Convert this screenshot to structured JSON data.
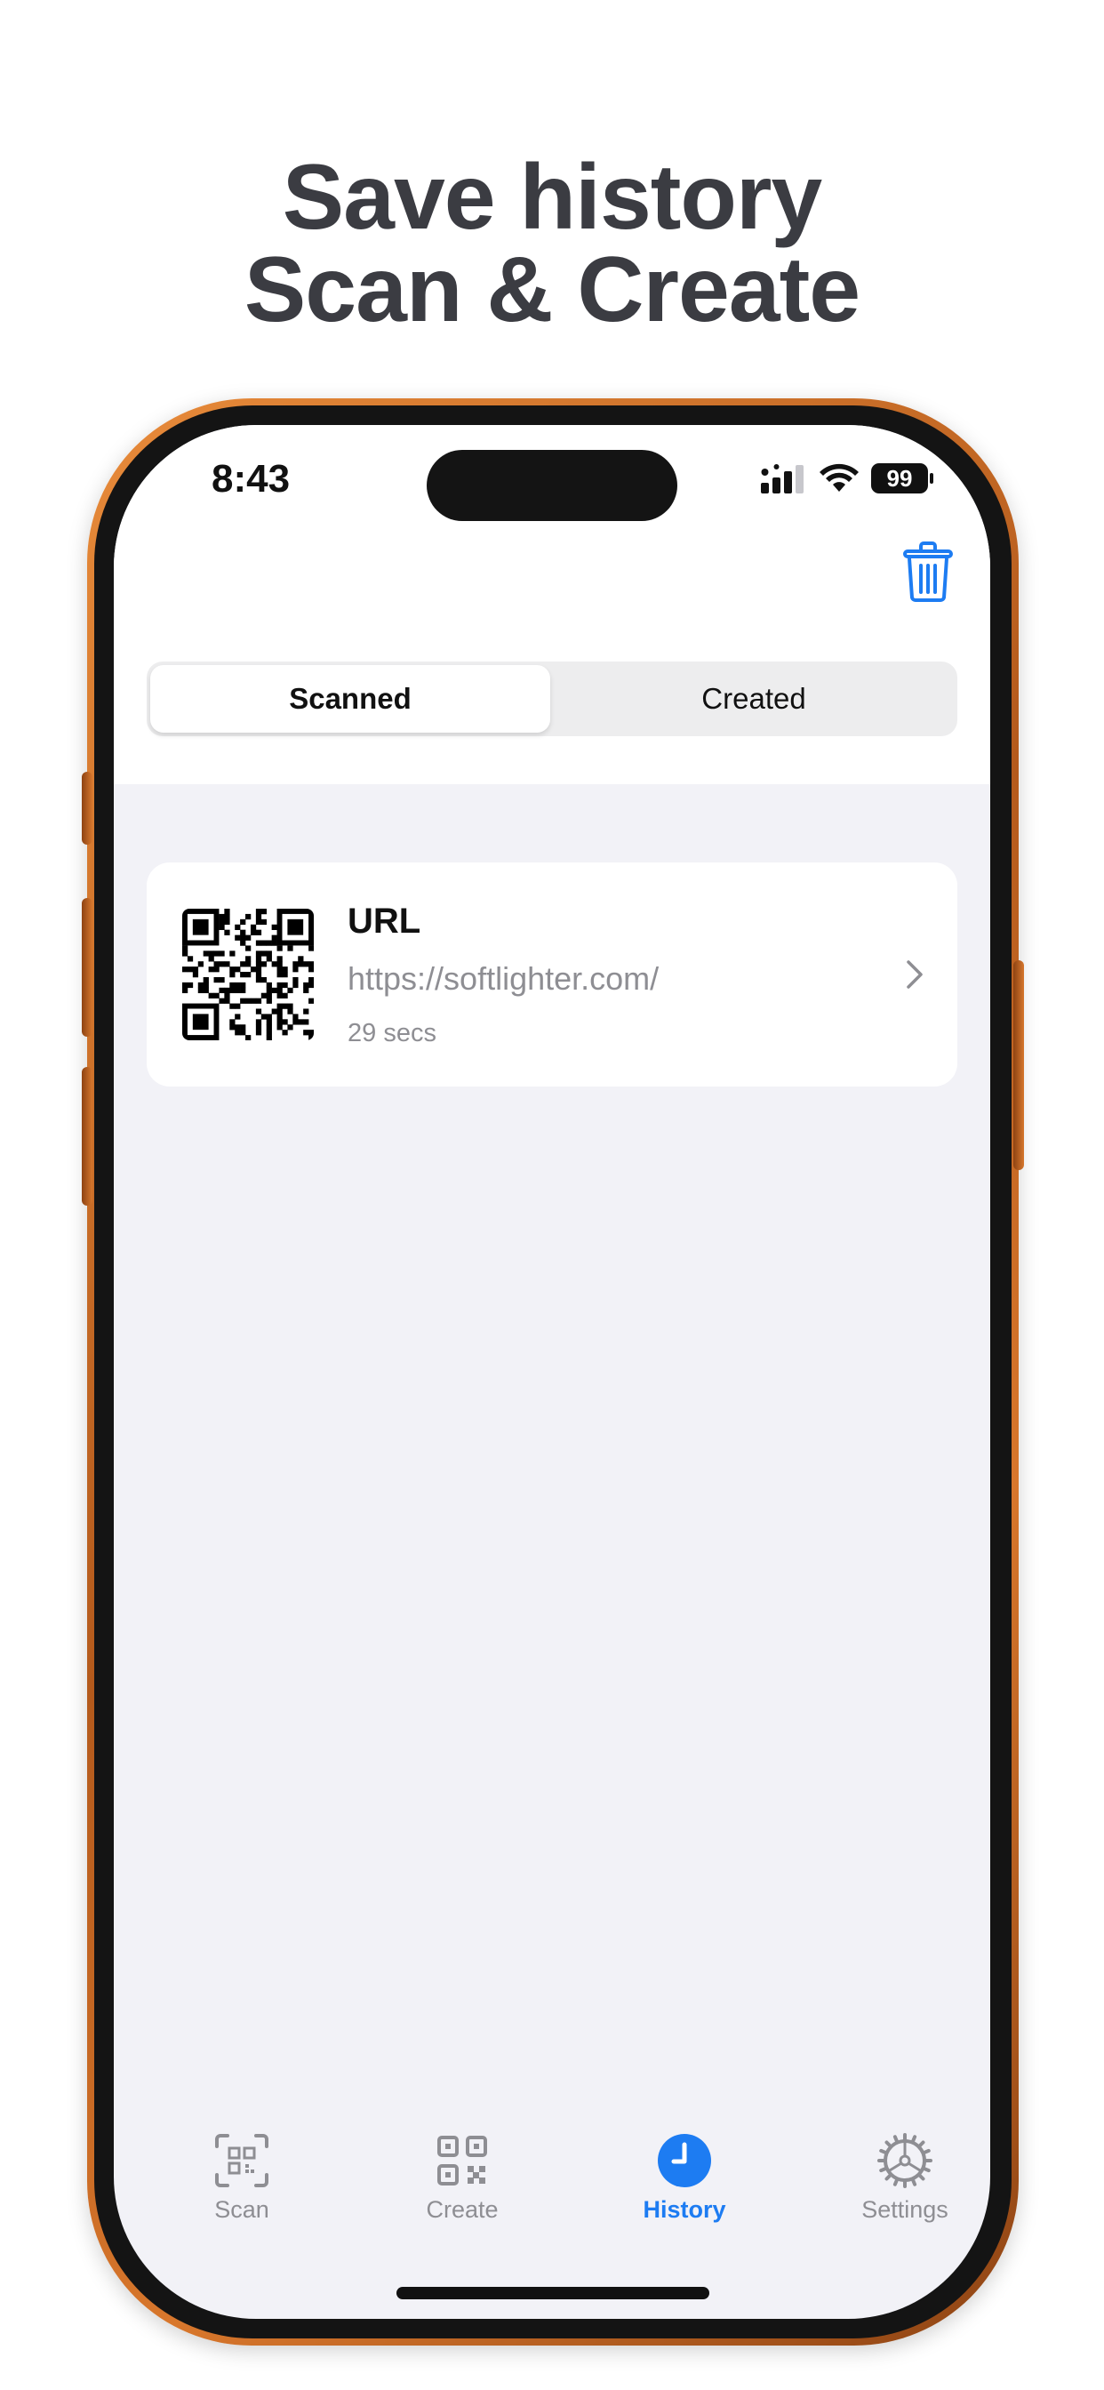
{
  "headline": {
    "line1": "Save history",
    "line2": "Scan & Create"
  },
  "status_bar": {
    "time": "8:43",
    "battery": "99"
  },
  "segmented": {
    "scanned": "Scanned",
    "created": "Created",
    "selected": "Scanned"
  },
  "history": {
    "items": [
      {
        "type": "URL",
        "value": "https://softlighter.com/",
        "age": "29 secs"
      }
    ]
  },
  "tabbar": {
    "items": [
      {
        "label": "Scan",
        "icon": "scan-qr-icon"
      },
      {
        "label": "Create",
        "icon": "qr-code-icon"
      },
      {
        "label": "History",
        "icon": "clock-icon"
      },
      {
        "label": "Settings",
        "icon": "gear-icon"
      }
    ],
    "active": "History"
  },
  "colors": {
    "accent": "#1d7cf2",
    "headline": "#3b3c42",
    "frame": "#d8772c",
    "background": "#f2f2f7"
  }
}
